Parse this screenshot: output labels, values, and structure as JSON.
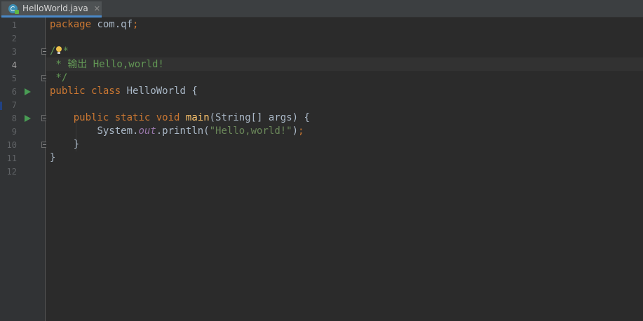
{
  "tab": {
    "filename": "HelloWorld.java",
    "close_glyph": "✕"
  },
  "gutter": {
    "line_numbers": [
      "1",
      "2",
      "3",
      "4",
      "5",
      "6",
      "7",
      "8",
      "9",
      "10",
      "11",
      "12"
    ],
    "current_line": "4"
  },
  "code": {
    "line1": {
      "keyword": "package",
      "rest": " com.qf",
      "semi": ";"
    },
    "line3": {
      "open": "/",
      "star": "*"
    },
    "line4": {
      "text": " * 输出 Hello,world!"
    },
    "line5": {
      "text": " */"
    },
    "line6": {
      "kw_public": "public",
      "kw_class": "class",
      "rest": " HelloWorld {"
    },
    "line8": {
      "kw_public": "public",
      "kw_static": "static",
      "kw_void": "void",
      "method": "main",
      "params": "(String[] args) {"
    },
    "line9": {
      "obj": "System.",
      "field": "out",
      "call": ".println(",
      "string": "\"Hello,world!\"",
      "close": ")",
      "semi": ";"
    },
    "line10": {
      "text": "}"
    },
    "line11": {
      "text": "}"
    }
  },
  "colors": {
    "background": "#2b2b2b",
    "gutter": "#313335",
    "keyword": "#cc7832",
    "method": "#ffc66d",
    "string": "#6a8759",
    "comment": "#629755",
    "static_field": "#9876aa",
    "default_text": "#a9b7c6",
    "run_icon": "#499c54"
  }
}
